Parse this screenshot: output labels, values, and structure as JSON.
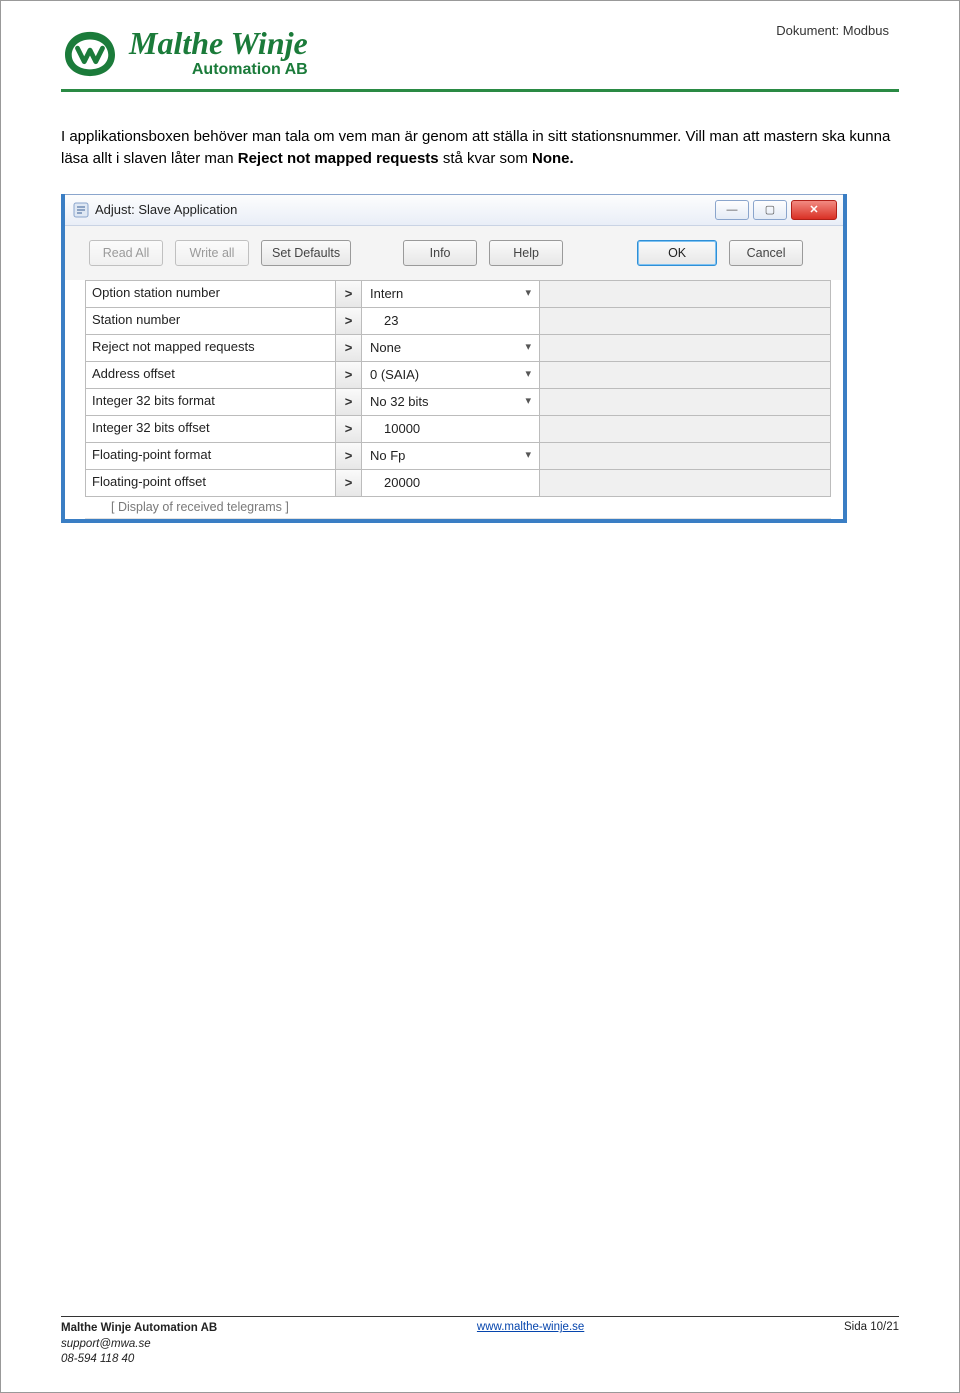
{
  "header": {
    "doc_label": "Dokument: Modbus"
  },
  "logo": {
    "main": "Malthe Winje",
    "sub": "Automation AB"
  },
  "body": {
    "p1a": "I applikationsboxen behöver man tala om vem man är genom att ställa in sitt stationsnummer. Vill man att mastern ska kunna läsa allt i slaven låter man ",
    "b1": "Reject not mapped requests",
    "p1b": " stå kvar som ",
    "b2": "None.",
    "p1c": ""
  },
  "dialog": {
    "title": "Adjust: Slave Application",
    "toolbar": {
      "read_all": "Read All",
      "write_all": "Write all",
      "set_defaults": "Set Defaults",
      "info": "Info",
      "help": "Help",
      "ok": "OK",
      "cancel": "Cancel"
    },
    "rows": [
      {
        "label": "Option station number",
        "value": "Intern",
        "dropdown": true
      },
      {
        "label": "Station number",
        "value": "23",
        "dropdown": false,
        "num": true
      },
      {
        "label": "Reject not mapped requests",
        "value": "None",
        "dropdown": true
      },
      {
        "label": "Address offset",
        "value": "0 (SAIA)",
        "dropdown": true
      },
      {
        "label": "Integer 32 bits format",
        "value": "No 32 bits",
        "dropdown": true
      },
      {
        "label": "Integer 32 bits offset",
        "value": "10000",
        "dropdown": false,
        "num": true
      },
      {
        "label": "Floating-point format",
        "value": "No Fp",
        "dropdown": true
      },
      {
        "label": "Floating-point offset",
        "value": "20000",
        "dropdown": false,
        "num": true
      }
    ],
    "cutline": "[ Display of received telegrams ]"
  },
  "footer": {
    "company": "Malthe Winje Automation AB",
    "email": "support@mwa.se",
    "phone": "08-594 118 40",
    "url": "www.malthe-winje.se",
    "page": "Sida 10/21"
  }
}
